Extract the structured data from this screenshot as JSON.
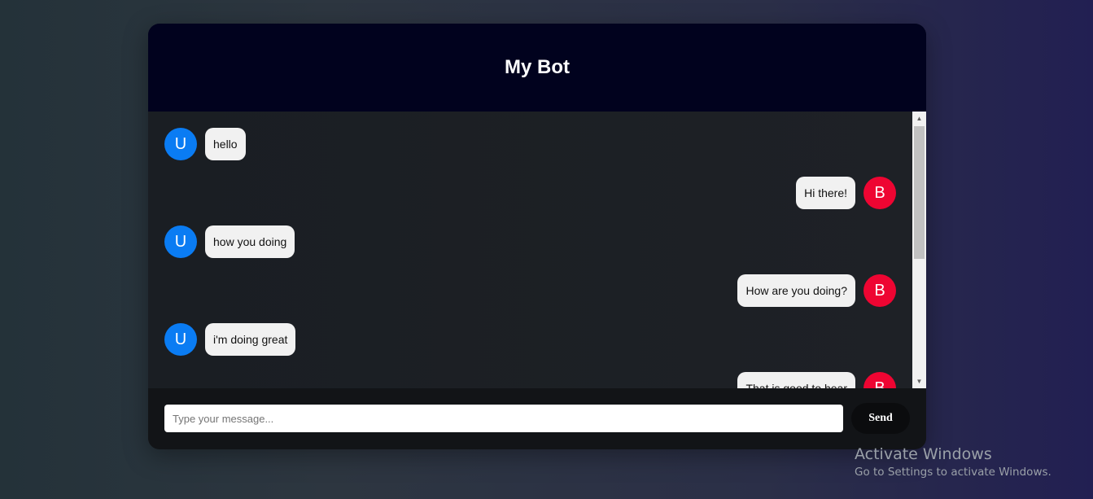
{
  "header": {
    "title": "My Bot"
  },
  "messages": [
    {
      "sender": "user",
      "avatar": "U",
      "text": "hello"
    },
    {
      "sender": "bot",
      "avatar": "B",
      "text": "Hi there!"
    },
    {
      "sender": "user",
      "avatar": "U",
      "text": "how you doing"
    },
    {
      "sender": "bot",
      "avatar": "B",
      "text": "How are you doing?"
    },
    {
      "sender": "user",
      "avatar": "U",
      "text": "i'm doing great"
    },
    {
      "sender": "bot",
      "avatar": "B",
      "text": "That is good to hear"
    }
  ],
  "composer": {
    "placeholder": "Type your message...",
    "value": "",
    "send_label": "Send"
  },
  "watermark": {
    "title": "Activate Windows",
    "subtitle": "Go to Settings to activate Windows."
  },
  "colors": {
    "user_avatar": "#0a7cf3",
    "bot_avatar": "#ee0532",
    "header_bg": "#01021e",
    "bubble_bg": "#f1f1f1"
  },
  "icons": {
    "scroll_up": "triangle-up-icon",
    "scroll_down": "triangle-down-icon"
  }
}
